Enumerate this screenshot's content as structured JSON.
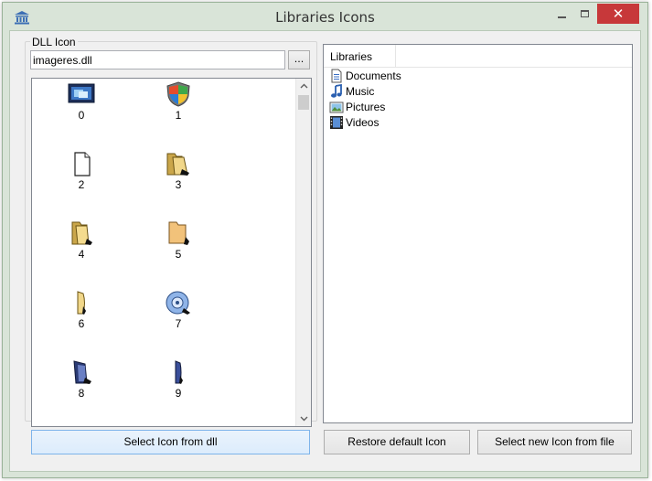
{
  "window": {
    "title": "Libraries Icons"
  },
  "dll_group": {
    "legend": "DLL Icon",
    "path_value": "imageres.dll",
    "browse_label": "..."
  },
  "icons": [
    {
      "label": "0",
      "icon": "monitor-icon"
    },
    {
      "label": "1",
      "icon": "security-shield-icon"
    },
    {
      "label": "2",
      "icon": "blank-document-icon"
    },
    {
      "label": "3",
      "icon": "folder-open-icon"
    },
    {
      "label": "4",
      "icon": "folder-icon"
    },
    {
      "label": "5",
      "icon": "folder-closed-icon"
    },
    {
      "label": "6",
      "icon": "folder-side-icon"
    },
    {
      "label": "7",
      "icon": "disc-drive-icon"
    },
    {
      "label": "8",
      "icon": "dark-folder-icon"
    },
    {
      "label": "9",
      "icon": "dark-folder-side-icon"
    }
  ],
  "libraries": {
    "header": "Libraries",
    "items": [
      {
        "label": "Documents",
        "icon": "documents-icon"
      },
      {
        "label": "Music",
        "icon": "music-note-icon"
      },
      {
        "label": "Pictures",
        "icon": "pictures-icon"
      },
      {
        "label": "Videos",
        "icon": "film-strip-icon"
      }
    ]
  },
  "buttons": {
    "select_from_dll": "Select Icon from dll",
    "restore_default": "Restore default Icon",
    "select_from_file": "Select new Icon from file"
  },
  "colors": {
    "close_button": "#c7383a",
    "window_frame": "#d9e4d8",
    "focus_border": "#7eb4ea"
  }
}
